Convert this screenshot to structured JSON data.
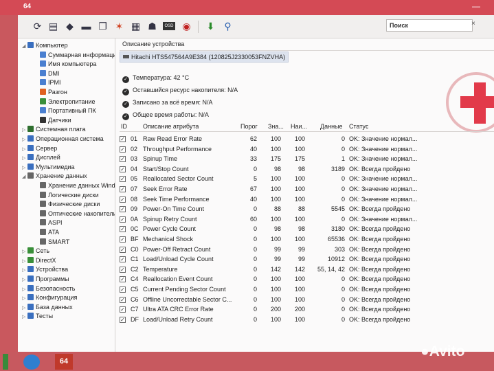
{
  "titlebar": {
    "app_icon": "64",
    "title": "",
    "controls": "—"
  },
  "toolbar": {
    "icons": [
      "refresh-icon",
      "report-icon",
      "network-icon",
      "monitor-icon",
      "copy-icon",
      "favorites-icon",
      "clipboard-icon",
      "user-icon",
      "osd-icon",
      "gauge-icon",
      "download-icon",
      "search-icon"
    ],
    "search_value": "Поиск",
    "search_clear": "×"
  },
  "sidebar": {
    "items": [
      {
        "label": "Компьютер",
        "level": 0,
        "expanded": true,
        "icon": "computer-icon",
        "color": "#3a6fbf"
      },
      {
        "label": "Суммарная информация",
        "level": 1,
        "icon": "summary-icon",
        "color": "#4a7fd0"
      },
      {
        "label": "Имя компьютера",
        "level": 1,
        "icon": "computer-name-icon",
        "color": "#4a7fd0"
      },
      {
        "label": "DMI",
        "level": 1,
        "icon": "dmi-icon",
        "color": "#4a7fd0"
      },
      {
        "label": "IPMI",
        "level": 1,
        "icon": "ipmi-icon",
        "color": "#4a7fd0"
      },
      {
        "label": "Разгон",
        "level": 1,
        "icon": "overclock-icon",
        "color": "#e06020"
      },
      {
        "label": "Электропитание",
        "level": 1,
        "icon": "power-icon",
        "color": "#3a8f3a"
      },
      {
        "label": "Портативный ПК",
        "level": 1,
        "icon": "laptop-icon",
        "color": "#4a7fd0"
      },
      {
        "label": "Датчики",
        "level": 1,
        "icon": "sensors-icon",
        "color": "#333333"
      },
      {
        "label": "Системная плата",
        "level": 0,
        "icon": "motherboard-icon",
        "color": "#2f6f2f"
      },
      {
        "label": "Операционная система",
        "level": 0,
        "icon": "os-icon",
        "color": "#3a6fbf"
      },
      {
        "label": "Сервер",
        "level": 0,
        "icon": "server-icon",
        "color": "#3a6fbf"
      },
      {
        "label": "Дисплей",
        "level": 0,
        "icon": "display-icon",
        "color": "#3a6fbf"
      },
      {
        "label": "Мультимедиа",
        "level": 0,
        "icon": "multimedia-icon",
        "color": "#3a6fbf"
      },
      {
        "label": "Хранение данных",
        "level": 0,
        "expanded": true,
        "icon": "storage-icon",
        "color": "#666666"
      },
      {
        "label": "Хранение данных Windows",
        "level": 1,
        "icon": "storage-windows-icon",
        "color": "#666666"
      },
      {
        "label": "Логические диски",
        "level": 1,
        "icon": "logical-disks-icon",
        "color": "#666666"
      },
      {
        "label": "Физические диски",
        "level": 1,
        "icon": "physical-disks-icon",
        "color": "#666666"
      },
      {
        "label": "Оптические накопители",
        "level": 1,
        "icon": "optical-drives-icon",
        "color": "#666666"
      },
      {
        "label": "ASPI",
        "level": 1,
        "icon": "aspi-icon",
        "color": "#666666"
      },
      {
        "label": "ATA",
        "level": 1,
        "icon": "ata-icon",
        "color": "#666666"
      },
      {
        "label": "SMART",
        "level": 1,
        "icon": "smart-icon",
        "color": "#666666"
      },
      {
        "label": "Сеть",
        "level": 0,
        "icon": "network-icon",
        "color": "#3a8f3a"
      },
      {
        "label": "DirectX",
        "level": 0,
        "icon": "directx-icon",
        "color": "#3a8f3a"
      },
      {
        "label": "Устройства",
        "level": 0,
        "icon": "devices-icon",
        "color": "#3a6fbf"
      },
      {
        "label": "Программы",
        "level": 0,
        "icon": "programs-icon",
        "color": "#3a6fbf"
      },
      {
        "label": "Безопасность",
        "level": 0,
        "icon": "security-icon",
        "color": "#3a6fbf"
      },
      {
        "label": "Конфигурация",
        "level": 0,
        "icon": "config-icon",
        "color": "#3a6fbf"
      },
      {
        "label": "База данных",
        "level": 0,
        "icon": "database-icon",
        "color": "#3a6fbf"
      },
      {
        "label": "Тесты",
        "level": 0,
        "icon": "tests-icon",
        "color": "#3a6fbf"
      }
    ]
  },
  "device": {
    "header": "Описание устройства",
    "name": "Hitachi HTS547564A9E384 (120825J2330053FNZVHA)",
    "info": [
      {
        "label": "Температура: 42 °C"
      },
      {
        "label": "Оставшийся ресурс накопителя: N/A"
      },
      {
        "label": "Записано за всё время: N/A"
      },
      {
        "label": "Общее время работы: N/A"
      }
    ]
  },
  "table": {
    "headers": {
      "id": "ID",
      "desc": "Описание атрибута",
      "thresh": "Порог",
      "value": "Зна...",
      "worst": "Наи...",
      "data": "Данные",
      "status": "Статус"
    },
    "rows": [
      {
        "id": "01",
        "desc": "Raw Read Error Rate",
        "thresh": "62",
        "value": "100",
        "worst": "100",
        "data": "0",
        "status": "OK: Значение нормал..."
      },
      {
        "id": "02",
        "desc": "Throughput Performance",
        "thresh": "40",
        "value": "100",
        "worst": "100",
        "data": "0",
        "status": "OK: Значение нормал..."
      },
      {
        "id": "03",
        "desc": "Spinup Time",
        "thresh": "33",
        "value": "175",
        "worst": "175",
        "data": "1",
        "status": "OK: Значение нормал..."
      },
      {
        "id": "04",
        "desc": "Start/Stop Count",
        "thresh": "0",
        "value": "98",
        "worst": "98",
        "data": "3189",
        "status": "OK: Всегда пройдено"
      },
      {
        "id": "05",
        "desc": "Reallocated Sector Count",
        "thresh": "5",
        "value": "100",
        "worst": "100",
        "data": "0",
        "status": "OK: Значение нормал..."
      },
      {
        "id": "07",
        "desc": "Seek Error Rate",
        "thresh": "67",
        "value": "100",
        "worst": "100",
        "data": "0",
        "status": "OK: Значение нормал..."
      },
      {
        "id": "08",
        "desc": "Seek Time Performance",
        "thresh": "40",
        "value": "100",
        "worst": "100",
        "data": "0",
        "status": "OK: Значение нормал..."
      },
      {
        "id": "09",
        "desc": "Power-On Time Count",
        "thresh": "0",
        "value": "88",
        "worst": "88",
        "data": "5545",
        "status": "OK: Всегда пройдено"
      },
      {
        "id": "0A",
        "desc": "Spinup Retry Count",
        "thresh": "60",
        "value": "100",
        "worst": "100",
        "data": "0",
        "status": "OK: Значение нормал..."
      },
      {
        "id": "0C",
        "desc": "Power Cycle Count",
        "thresh": "0",
        "value": "98",
        "worst": "98",
        "data": "3180",
        "status": "OK: Всегда пройдено"
      },
      {
        "id": "BF",
        "desc": "Mechanical Shock",
        "thresh": "0",
        "value": "100",
        "worst": "100",
        "data": "65536",
        "status": "OK: Всегда пройдено"
      },
      {
        "id": "C0",
        "desc": "Power-Off Retract Count",
        "thresh": "0",
        "value": "99",
        "worst": "99",
        "data": "303",
        "status": "OK: Всегда пройдено"
      },
      {
        "id": "C1",
        "desc": "Load/Unload Cycle Count",
        "thresh": "0",
        "value": "99",
        "worst": "99",
        "data": "10912",
        "status": "OK: Всегда пройдено"
      },
      {
        "id": "C2",
        "desc": "Temperature",
        "thresh": "0",
        "value": "142",
        "worst": "142",
        "data": "55, 14, 42",
        "status": "OK: Всегда пройдено"
      },
      {
        "id": "C4",
        "desc": "Reallocation Event Count",
        "thresh": "0",
        "value": "100",
        "worst": "100",
        "data": "0",
        "status": "OK: Всегда пройдено"
      },
      {
        "id": "C5",
        "desc": "Current Pending Sector Count",
        "thresh": "0",
        "value": "100",
        "worst": "100",
        "data": "0",
        "status": "OK: Всегда пройдено"
      },
      {
        "id": "C6",
        "desc": "Offline Uncorrectable Sector C...",
        "thresh": "0",
        "value": "100",
        "worst": "100",
        "data": "0",
        "status": "OK: Всегда пройдено"
      },
      {
        "id": "C7",
        "desc": "Ultra ATA CRC Error Rate",
        "thresh": "0",
        "value": "200",
        "worst": "200",
        "data": "0",
        "status": "OK: Всегда пройдено"
      },
      {
        "id": "DF",
        "desc": "Load/Unload Retry Count",
        "thresh": "0",
        "value": "100",
        "worst": "100",
        "data": "0",
        "status": "OK: Всегда пройдено"
      }
    ]
  },
  "taskbar": {
    "app_label": "64"
  },
  "watermark": {
    "text": "Avito"
  },
  "colors": {
    "accent": "#d44a55",
    "background": "#c9585e",
    "window": "#f4f2f1"
  }
}
